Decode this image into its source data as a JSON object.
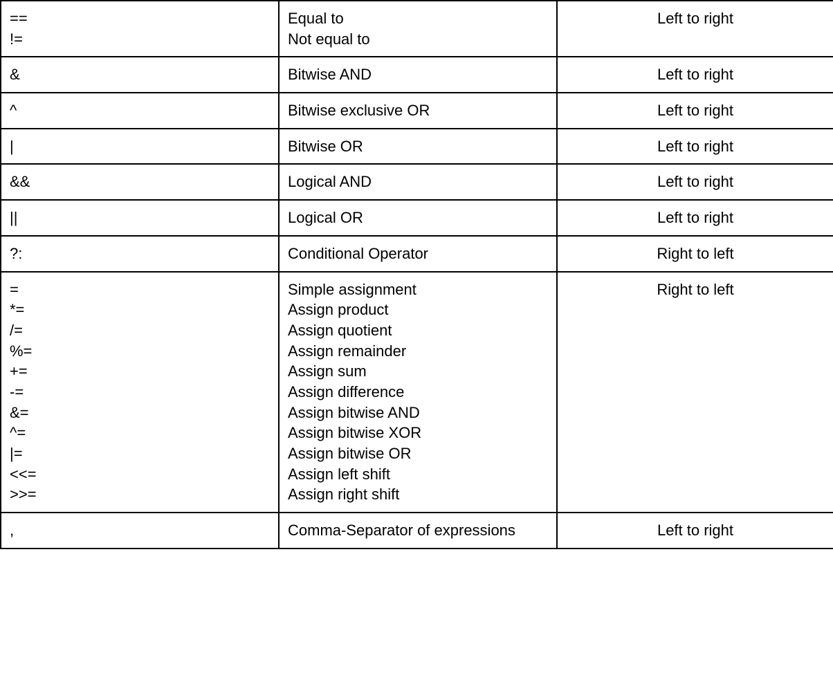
{
  "rows": [
    {
      "operator": "==\n!=",
      "description": "Equal to\nNot equal to",
      "associativity": "Left to right"
    },
    {
      "operator": "&",
      "description": "Bitwise AND",
      "associativity": "Left to right"
    },
    {
      "operator": "^",
      "description": "Bitwise exclusive OR",
      "associativity": "Left to right"
    },
    {
      "operator": "|",
      "description": "Bitwise OR",
      "associativity": "Left to right"
    },
    {
      "operator": "&&",
      "description": "Logical AND",
      "associativity": "Left to right"
    },
    {
      "operator": "||",
      "description": "Logical OR",
      "associativity": "Left to right"
    },
    {
      "operator": "?:",
      "description": "Conditional Operator",
      "associativity": "Right to left"
    },
    {
      "operator": "=\n*=\n/=\n%=\n+=\n-=\n&=\n^=\n|=\n<<=\n>>=",
      "description": "Simple assignment\nAssign product\nAssign quotient\nAssign remainder\nAssign sum\nAssign difference\nAssign bitwise AND\nAssign bitwise XOR\nAssign bitwise OR\nAssign left shift\nAssign right shift",
      "associativity": "Right to left"
    },
    {
      "operator": ",",
      "description": "Comma-Separator of expressions",
      "associativity": "Left to right"
    }
  ]
}
